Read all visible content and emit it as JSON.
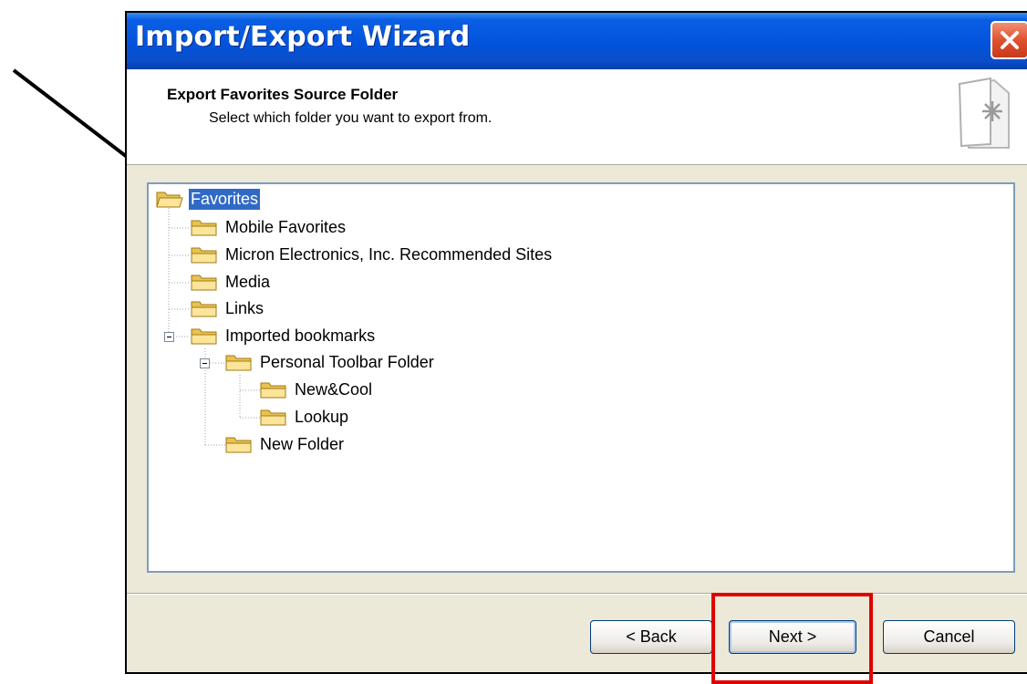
{
  "window": {
    "title": "Import/Export Wizard",
    "close_label": "Close"
  },
  "header": {
    "title": "Export Favorites Source Folder",
    "subtitle": "Select which folder you want to export from."
  },
  "tree": {
    "nodes": [
      {
        "label": "Favorites",
        "selected": true
      },
      {
        "label": "Mobile Favorites"
      },
      {
        "label": "Micron Electronics, Inc. Recommended Sites"
      },
      {
        "label": "Media"
      },
      {
        "label": "Links"
      },
      {
        "label": "Imported bookmarks",
        "expanded": true
      },
      {
        "label": "Personal Toolbar Folder",
        "expanded": true
      },
      {
        "label": "New&Cool"
      },
      {
        "label": "Lookup"
      },
      {
        "label": "New Folder"
      }
    ]
  },
  "buttons": {
    "back": "< Back",
    "next": "Next >",
    "cancel": "Cancel"
  },
  "colors": {
    "titlebar": "#0253dc",
    "selection": "#316ac5",
    "annotation_box": "#e00000"
  }
}
